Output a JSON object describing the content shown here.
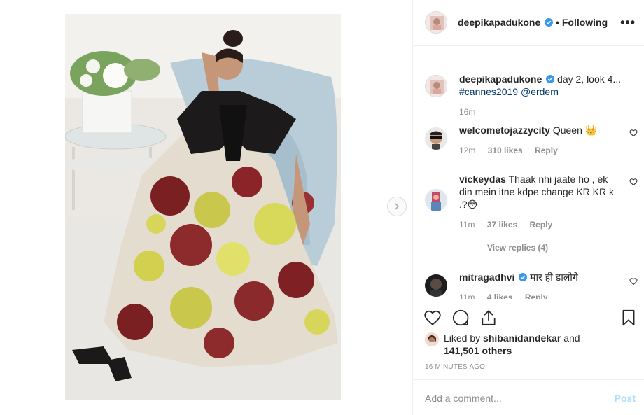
{
  "post": {
    "username": "deepikapadukone",
    "follow_status": "Following",
    "separator": "•",
    "more_label": "•••",
    "next_label": "›"
  },
  "caption": {
    "username": "deepikapadukone",
    "text": "day 2, look 4...",
    "hashtag": "#cannes2019",
    "mention": "@erdem",
    "time": "16m"
  },
  "comments": [
    {
      "username": "welcometojazzycity",
      "text": "Queen 👑",
      "time": "12m",
      "likes": "310 likes",
      "reply_label": "Reply"
    },
    {
      "username": "vickeydas",
      "text": "Thaak nhi jaate ho , ek din mein itne kdpe change KR KR k .?😳",
      "time": "11m",
      "likes": "37 likes",
      "reply_label": "Reply",
      "view_replies": "View replies (4)"
    },
    {
      "username": "mitragadhvi",
      "text": "मार ही डालोगे",
      "time": "11m",
      "likes": "4 likes",
      "reply_label": "Reply"
    }
  ],
  "likes": {
    "prefix": "Liked by",
    "user": "shibanidandekar",
    "connector": "and",
    "count": "141,501 others"
  },
  "timestamp": "16 MINUTES AGO",
  "add_comment": {
    "placeholder": "Add a comment...",
    "post_label": "Post"
  },
  "colors": {
    "verified": "#3897f0",
    "link": "#003569",
    "muted": "#8e8e8e",
    "post_disabled": "#b2dffc"
  }
}
